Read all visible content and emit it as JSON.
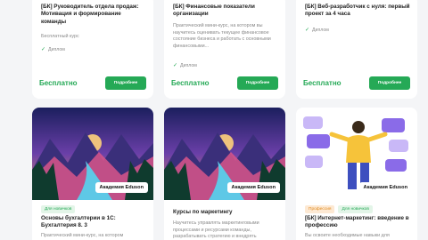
{
  "cards_top": [
    {
      "title": "[БК] Руководитель отдела продаж: Мотивация и формирование команды",
      "description": "Бесплатный курс",
      "diploma": "Диплом",
      "price": "Бесплатно",
      "button": "Подробнее"
    },
    {
      "title": "[БК] Финансовые показатели организации",
      "description": "Практический мини-курс, на котором вы научитесь оценивать текущее финансовое состояние бизнеса и работать с основными финансовыми...",
      "diploma": "Диплом",
      "price": "Бесплатно",
      "button": "Подробнее"
    },
    {
      "title": "[БК] Веб-разработчик с нуля: первый проект за 4 часа",
      "description": "",
      "diploma": "Диплом",
      "price": "Бесплатно",
      "button": "Подробнее"
    }
  ],
  "cards_bottom": [
    {
      "badge": "Академия Eduson",
      "tags": [
        "Для новичков"
      ],
      "title": "Основы бухгалтерии в 1С: Бухгалтерия 8. 3",
      "description": "Практический мини-курс, на котором"
    },
    {
      "badge": "Академия Eduson",
      "tags": [],
      "title": "Курсы по маркетингу",
      "description": "Научитесь управлять маркетинговыми процессами и ресурсами команды, разрабатывать стратегию и внедрять"
    },
    {
      "badge": "Академия Eduson",
      "tags": [
        "Профессия",
        "Для новичков"
      ],
      "title": "[БК] Интернет-маркетинг: введение в профессию",
      "description": "Вы освоите необходимые навыки для"
    }
  ],
  "colors": {
    "accent": "#25a956",
    "background": "#f4f5f7"
  }
}
